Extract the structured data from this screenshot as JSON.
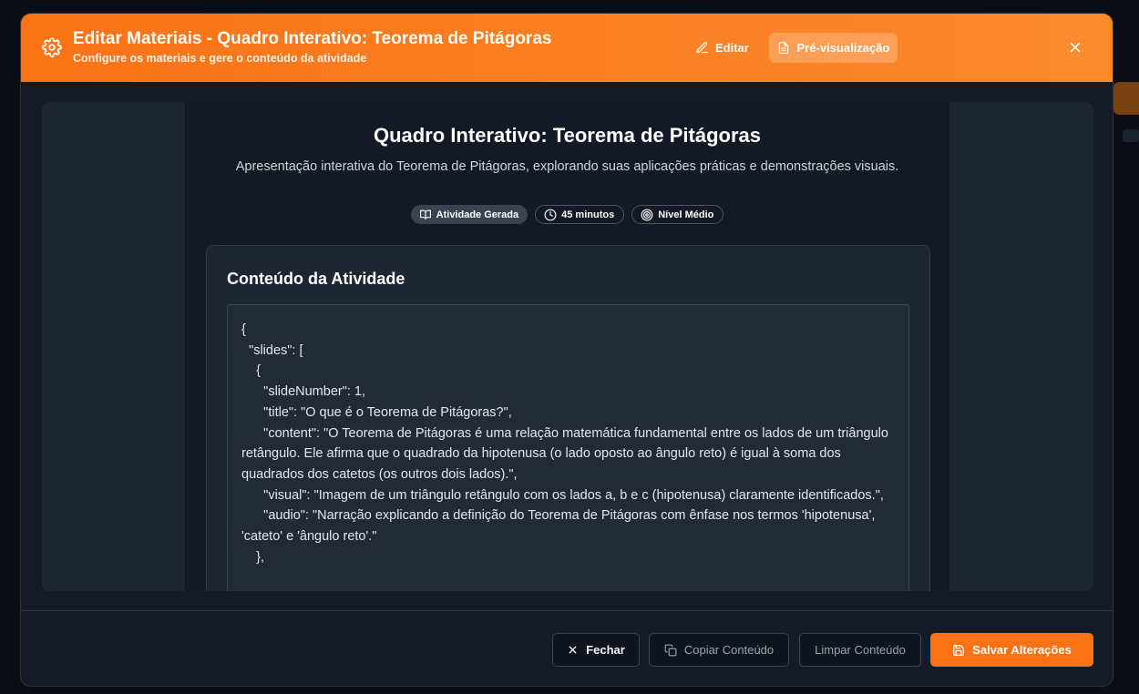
{
  "header": {
    "title": "Editar Materiais - Quadro Interativo: Teorema de Pitágoras",
    "subtitle": "Configure os materiais e gere o conteúdo da atividade",
    "edit_label": "Editar",
    "preview_label": "Pré-visualização",
    "icons": {
      "settings": "gear-icon",
      "edit": "pencil-icon",
      "preview": "file-text-icon",
      "close": "close-icon"
    }
  },
  "activity": {
    "title": "Quadro Interativo: Teorema de Pitágoras",
    "description": "Apresentação interativa do Teorema de Pitágoras, explorando suas aplicações práticas e demonstrações visuais.",
    "badges": [
      {
        "label": "Atividade Gerada",
        "icon": "book-open-icon"
      },
      {
        "label": "45 minutos",
        "icon": "clock-icon"
      },
      {
        "label": "Nível Médio",
        "icon": "target-icon"
      }
    ]
  },
  "content_card": {
    "title": "Conteúdo da Atividade",
    "code": "{\n  \"slides\": [\n    {\n      \"slideNumber\": 1,\n      \"title\": \"O que é o Teorema de Pitágoras?\",\n      \"content\": \"O Teorema de Pitágoras é uma relação matemática fundamental entre os lados de um triângulo retângulo. Ele afirma que o quadrado da hipotenusa (o lado oposto ao ângulo reto) é igual à soma dos quadrados dos catetos (os outros dois lados).\",\n      \"visual\": \"Imagem de um triângulo retângulo com os lados a, b e c (hipotenusa) claramente identificados.\",\n      \"audio\": \"Narração explicando a definição do Teorema de Pitágoras com ênfase nos termos 'hipotenusa', 'cateto' e 'ângulo reto'.\"\n    },"
  },
  "footer": {
    "close_label": "Fechar",
    "copy_label": "Copiar Conteúdo",
    "clear_label": "Limpar Conteúdo",
    "save_label": "Salvar Alterações"
  },
  "colors": {
    "accent": "#f97316",
    "modal_bg": "#151b26",
    "panel_bg": "#131925"
  }
}
